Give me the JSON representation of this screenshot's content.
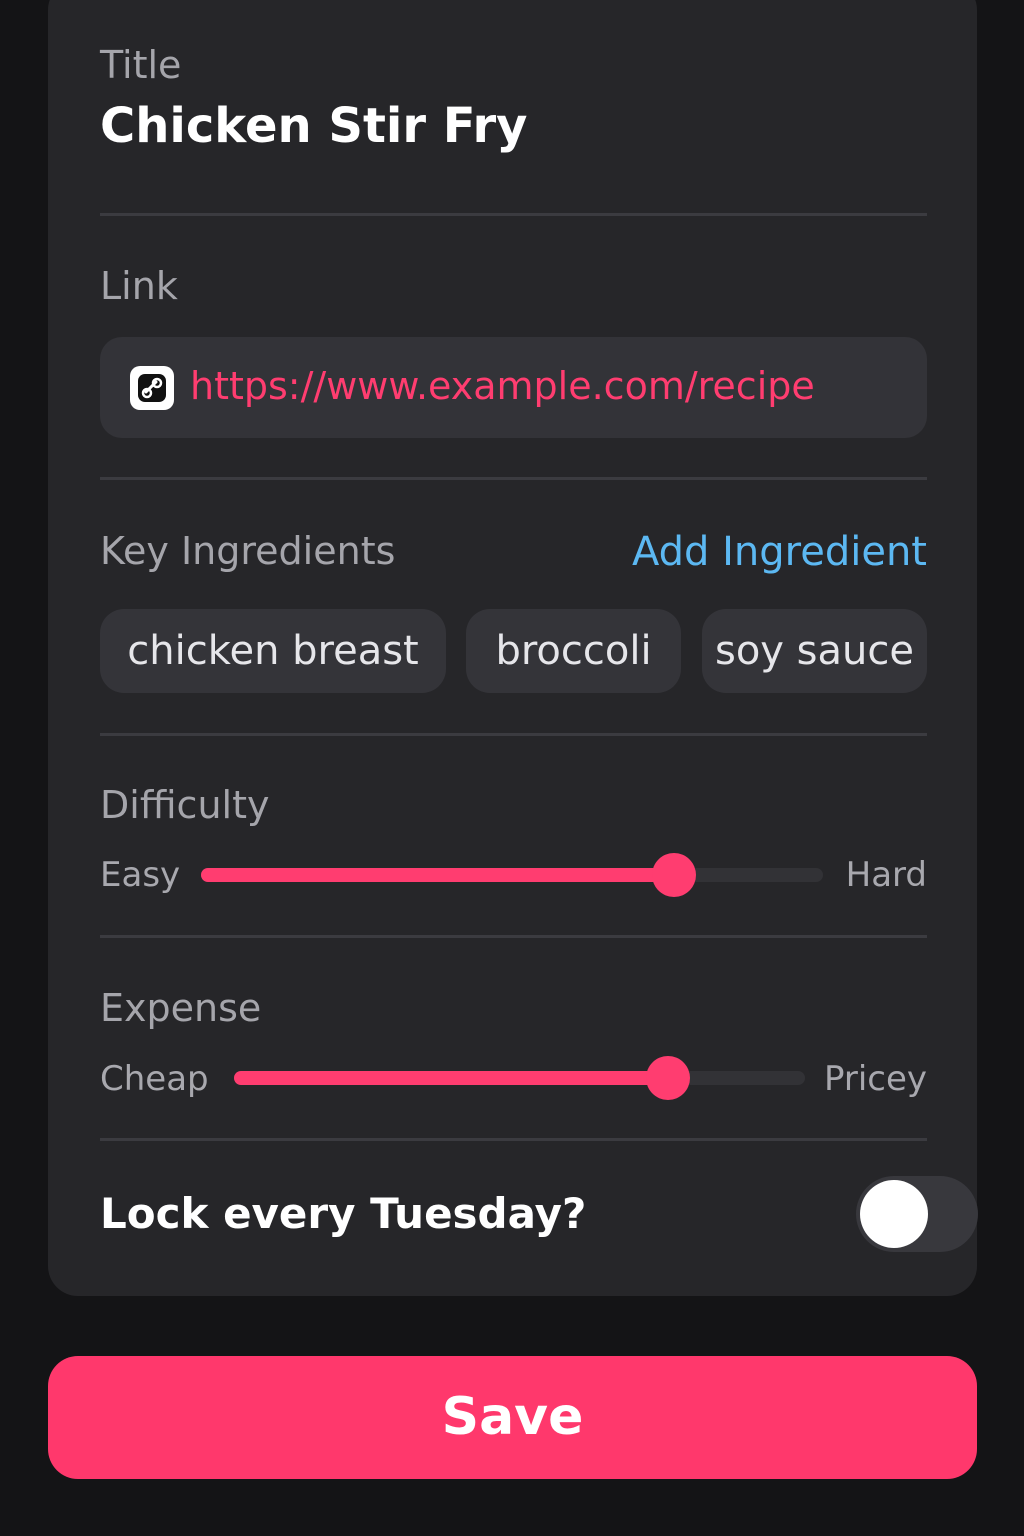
{
  "title_section": {
    "label": "Title",
    "value": "Chicken Stir Fry"
  },
  "link_section": {
    "label": "Link",
    "url": "https://www.example.com/recipe",
    "icon": "link-icon"
  },
  "ingredients_section": {
    "label": "Key Ingredients",
    "add_label": "Add Ingredient",
    "items": [
      "chicken breast",
      "broccoli",
      "soy sauce"
    ]
  },
  "difficulty": {
    "label": "Difficulty",
    "min_label": "Easy",
    "max_label": "Hard",
    "value": 0.76
  },
  "expense": {
    "label": "Expense",
    "min_label": "Cheap",
    "max_label": "Pricey",
    "value": 0.76
  },
  "lock": {
    "label": "Lock every Tuesday?",
    "enabled": false
  },
  "save_label": "Save",
  "colors": {
    "accent": "#ff3d70",
    "link_action": "#5cb8f2",
    "card": "#262629",
    "background": "#141416"
  }
}
